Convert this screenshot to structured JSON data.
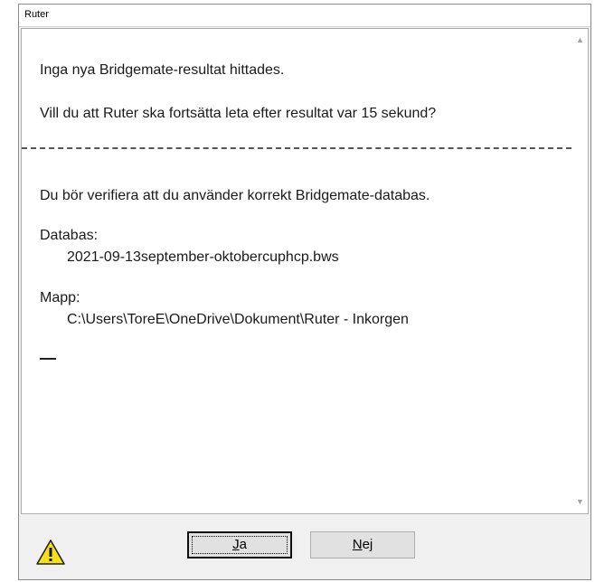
{
  "window": {
    "title": "Ruter"
  },
  "message": {
    "line1": "Inga nya Bridgemate-resultat hittades.",
    "line2": "Vill du att Ruter ska fortsätta leta efter resultat var 15 sekund?",
    "line3": "Du bör verifiera att du använder korrekt Bridgemate-databas.",
    "database_label": "Databas:",
    "database_value": "2021-09-13september-oktobercuphcp.bws",
    "folder_label": "Mapp:",
    "folder_value": "C:\\Users\\ToreE\\OneDrive\\Dokument\\Ruter - Inkorgen"
  },
  "buttons": {
    "yes_mnemonic": "J",
    "yes_rest": "a",
    "no_mnemonic": "N",
    "no_rest": "ej"
  },
  "icons": {
    "warning": "warning-icon",
    "scroll_up": "scroll-up-arrow-icon",
    "scroll_down": "scroll-down-arrow-icon"
  }
}
